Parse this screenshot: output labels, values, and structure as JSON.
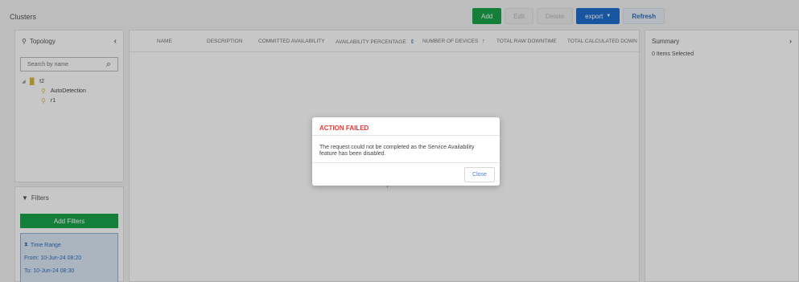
{
  "header": {
    "title": "Clusters",
    "buttons": {
      "add": "Add",
      "edit": "Edit",
      "delete": "Delete",
      "export": "export",
      "export_caret": "▼",
      "refresh": "Refresh"
    }
  },
  "topology": {
    "title": "Topology",
    "search_placeholder": "Search by name",
    "tree": {
      "root": "t2",
      "children": [
        "AutoDetection",
        "r1"
      ]
    }
  },
  "filters": {
    "title": "Filters",
    "add_filters": "Add Filters",
    "time_range": {
      "label": "Time Range",
      "from": "From: 10-Jun-24 08:20",
      "to": "To:   10-Jun-24 08:30"
    }
  },
  "table": {
    "columns": [
      "NAME",
      "DESCRIPTION",
      "COMMITTED AVAILABILITY",
      "AVAILABILITY PERCENTAGE",
      "NUMBER OF DEVICES",
      "TOTAL RAW DOWNTIME",
      "TOTAL CALCULATED DOWN"
    ],
    "sort_glyphs": {
      "availability": "⇕",
      "devices": "↑"
    }
  },
  "summary": {
    "title": "Summary",
    "selected": "0 Items Selected"
  },
  "modal": {
    "title": "ACTION FAILED",
    "message": "The request could not be completed as the Service Availability feature has been disabled.",
    "close": "Close"
  },
  "colors": {
    "green": "#1aa34a",
    "blue": "#1f6ecf",
    "error_red": "#e53935"
  }
}
